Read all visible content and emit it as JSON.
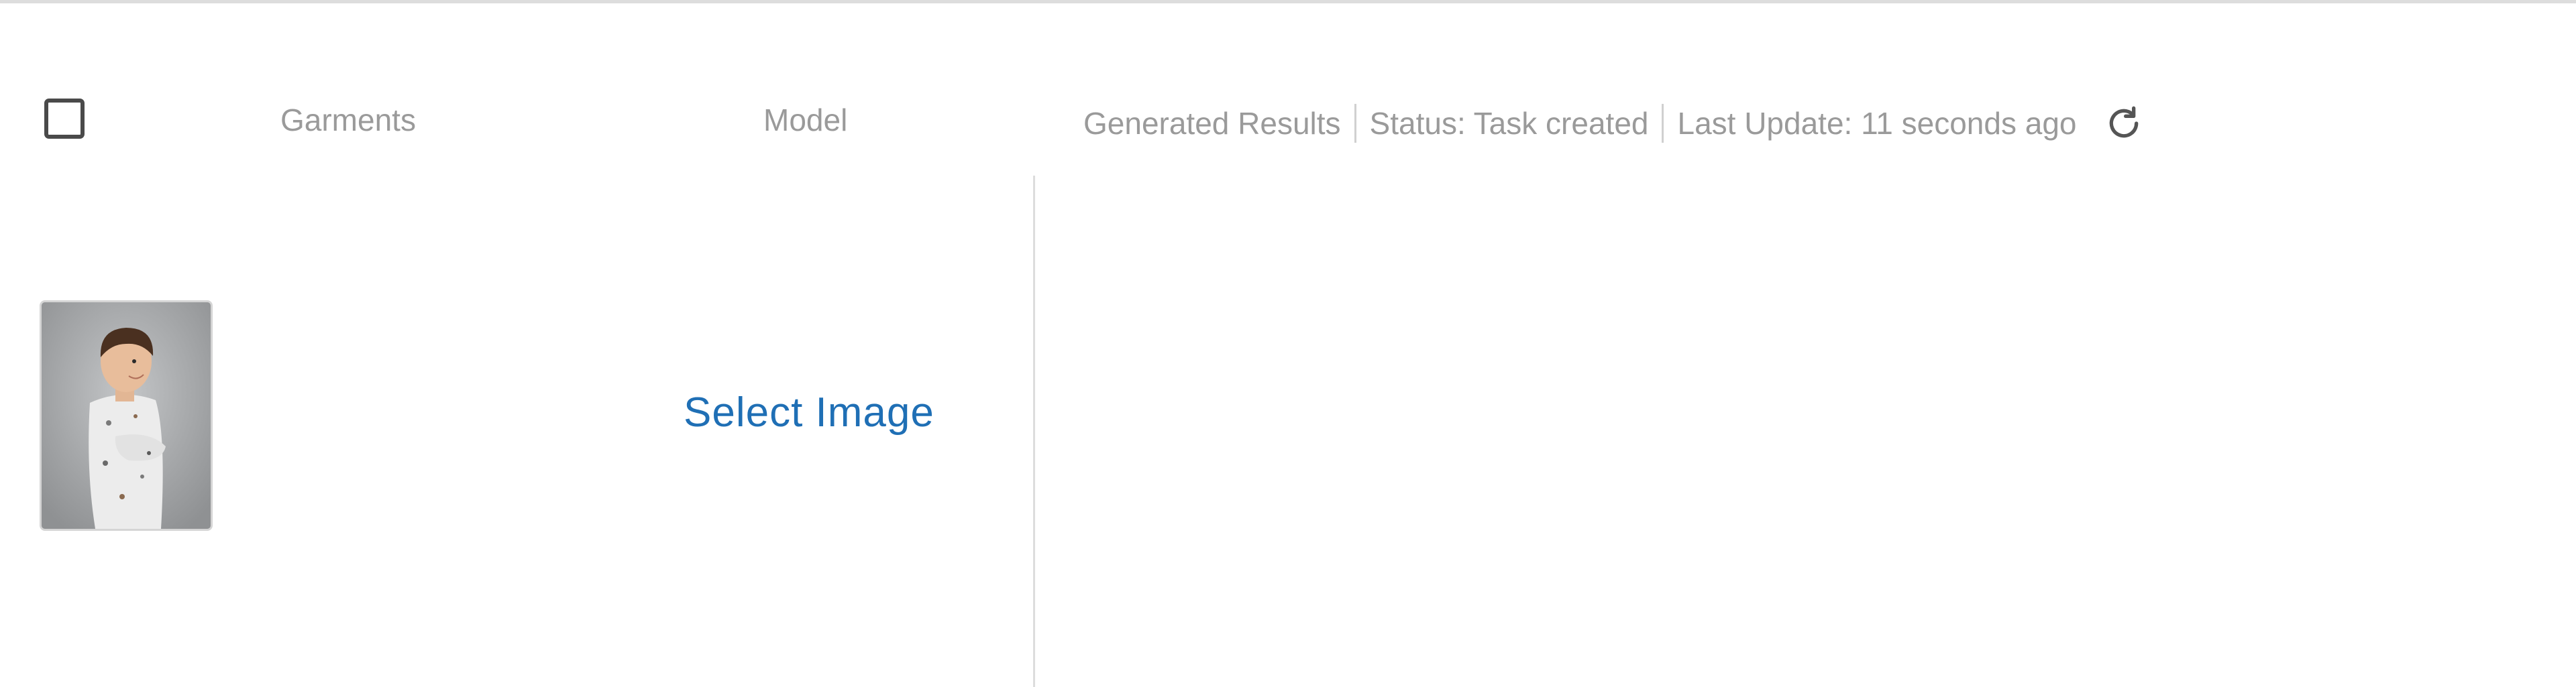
{
  "header": {
    "garments_label": "Garments",
    "model_label": "Model",
    "results_label": "Generated Results",
    "status_text": "Status: Task created",
    "last_update_text": "Last Update: 11 seconds ago",
    "refresh_icon": "refresh-icon"
  },
  "row": {
    "garment_thumbnail": "boy-portrait-photo",
    "select_image_label": "Select Image"
  },
  "colors": {
    "link": "#1f6fb5",
    "muted_text": "#9a9a9a",
    "divider": "#dddddd"
  }
}
